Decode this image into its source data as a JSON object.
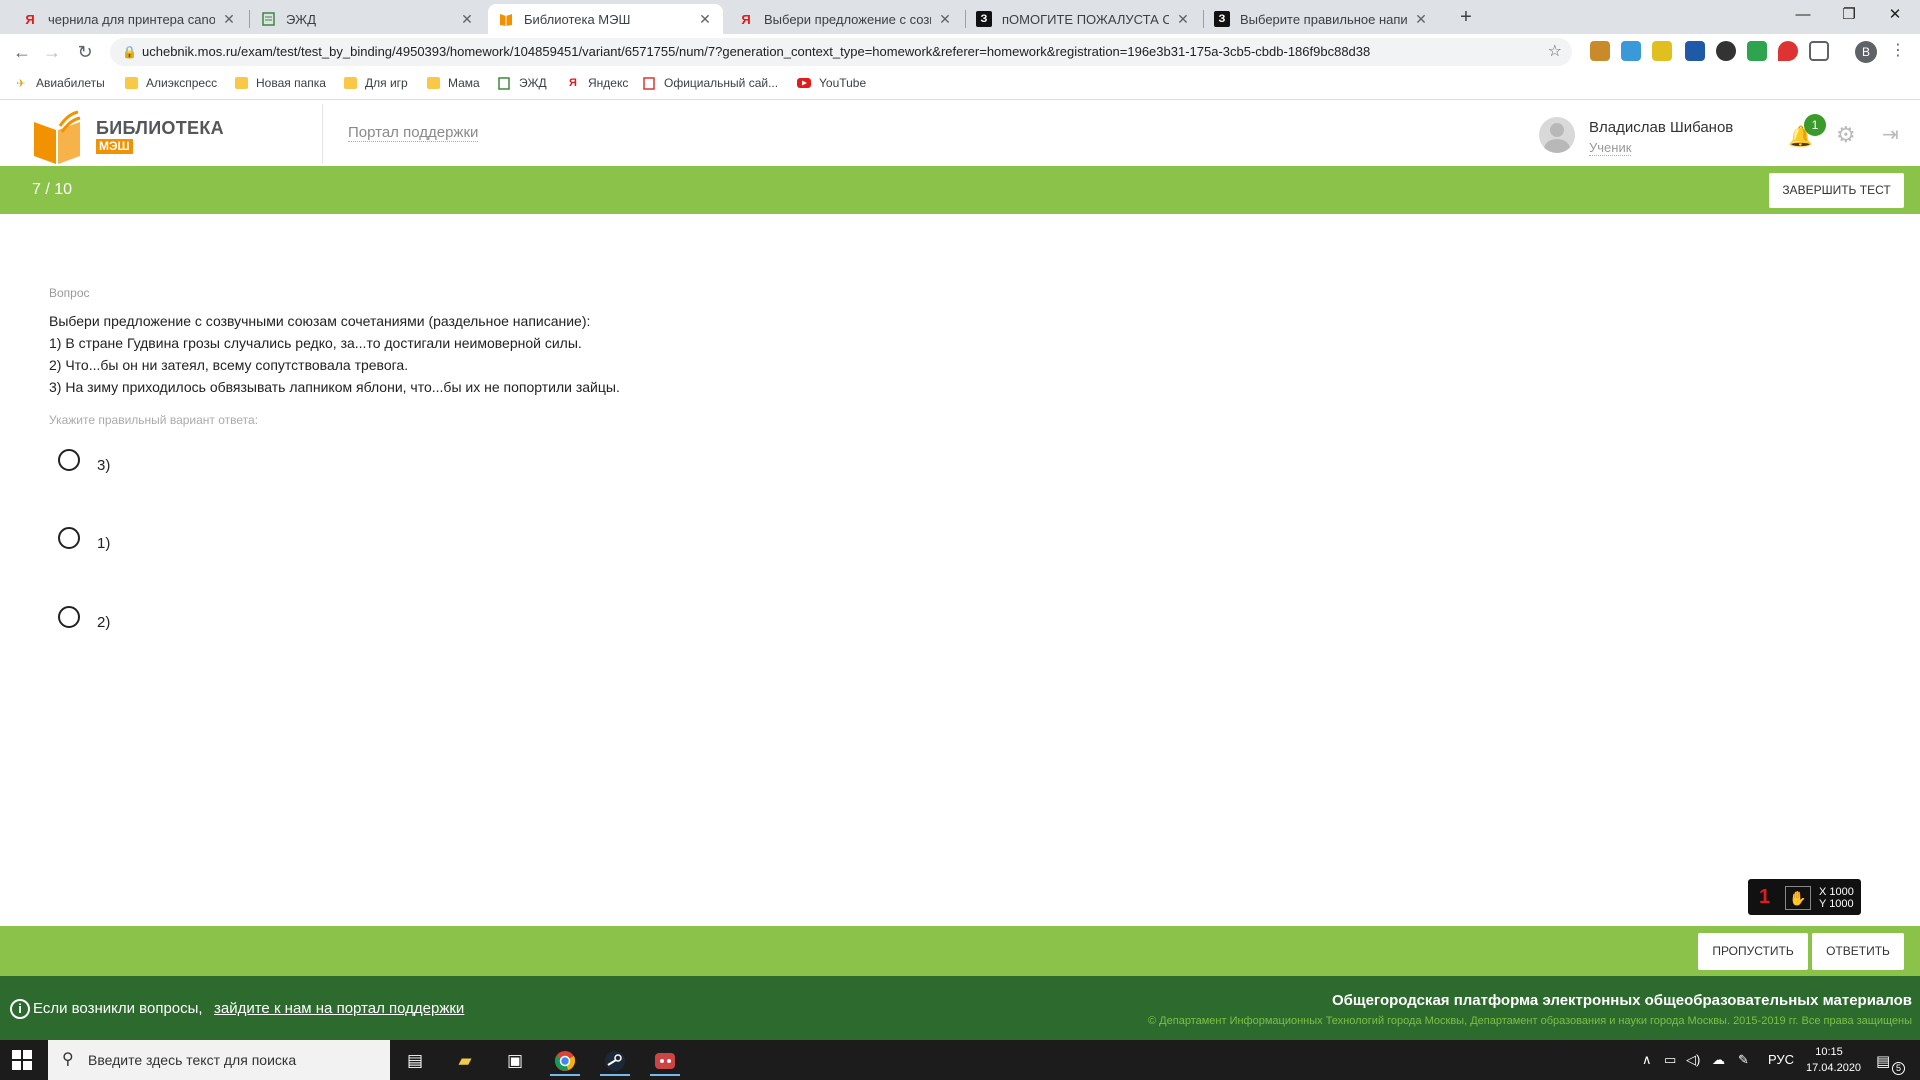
{
  "browser": {
    "tabs": [
      {
        "label": "чернила для принтера canon pi",
        "icon": "yandex-icon"
      },
      {
        "label": "ЭЖД",
        "icon": "document-icon"
      },
      {
        "label": "Библиотека МЭШ",
        "icon": "book-icon",
        "active": true
      },
      {
        "label": "Выбери предложение с созвуч",
        "icon": "yandex-icon"
      },
      {
        "label": "пОМОГИТЕ ПОЖАЛУСТА С ТЕС",
        "icon": "znanija-icon"
      },
      {
        "label": "Выберите правильное написан",
        "icon": "znanija-icon"
      }
    ],
    "tab_close": "✕",
    "new_tab": "+",
    "url": "uchebnik.mos.ru/exam/test/test_by_binding/4950393/homework/104859451/variant/6571755/num/7?generation_context_type=homework&referer=homework&registration=196e3b31-175a-3cb5-cbdb-186f9bc88d38",
    "profile_initial": "B",
    "bookmarks": [
      {
        "label": "Авиабилеты",
        "icon": "plane-icon"
      },
      {
        "label": "Алиэкспресс",
        "icon": "folder-icon"
      },
      {
        "label": "Новая папка",
        "icon": "folder-icon"
      },
      {
        "label": "Для игр",
        "icon": "folder-icon"
      },
      {
        "label": "Мама",
        "icon": "folder-icon"
      },
      {
        "label": "ЭЖД",
        "icon": "document-icon"
      },
      {
        "label": "Яндекс",
        "icon": "yandex-icon"
      },
      {
        "label": "Официальный сай...",
        "icon": "page-icon"
      },
      {
        "label": "YouTube",
        "icon": "youtube-icon"
      }
    ]
  },
  "header": {
    "logo_title": "БИБЛИОТЕКА",
    "logo_sub": "МЭШ",
    "support_link": "Портал поддержки",
    "user_name": "Владислав Шибанов",
    "user_role": "Ученик",
    "notifications": "1"
  },
  "progress": {
    "counter": "7 / 10",
    "finish_button": "ЗАВЕРШИТЬ ТЕСТ"
  },
  "question": {
    "label": "Вопрос",
    "lines": [
      "Выбери предложение с созвучными союзам сочетаниями (раздельное написание):",
      "1) В стране Гудвина грозы случались редко, за...то достигали неимоверной силы.",
      "2) Что...бы он ни затеял, всему сопутствовала тревога.",
      "3) На зиму приходилось обвязывать лапником яблони, что...бы их не попортили зайцы."
    ],
    "hint": "Укажите правильный вариант ответа:",
    "options": [
      "3)",
      "1)",
      "2)"
    ]
  },
  "widget": {
    "glyph": "1",
    "x_readout": "X 1000",
    "y_readout": "Y 1000"
  },
  "actions": {
    "skip": "ПРОПУСТИТЬ",
    "answer": "ОТВЕТИТЬ"
  },
  "footer": {
    "question_text": "Если возникли вопросы,",
    "support_link": "зайдите к нам на портал поддержки",
    "platform": "Общегородская платформа электронных общеобразовательных материалов",
    "copyright": "© Департамент Информационных Технологий города Москвы, Департамент образования и науки города Москвы. 2015-2019 гг. Все права защищены"
  },
  "taskbar": {
    "search_placeholder": "Введите здесь текст для поиска",
    "lang": "РУС",
    "time": "10:15",
    "date": "17.04.2020",
    "notif_count": "5"
  },
  "colors": {
    "accent_green": "#8bc34a",
    "footer_green": "#2d6a2e",
    "logo_orange": "#f39200"
  }
}
